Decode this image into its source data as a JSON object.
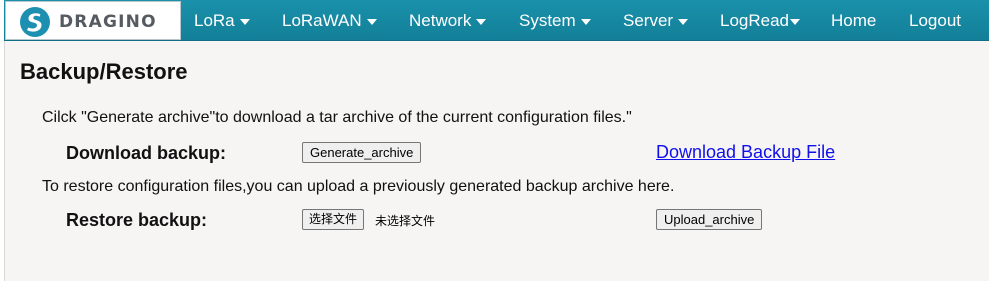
{
  "brand": {
    "logo_text": "DRAGINO"
  },
  "nav": {
    "lora": "LoRa",
    "lorawan": "LoRaWAN",
    "network": "Network",
    "system": "System",
    "server": "Server",
    "logread": "LogRead",
    "home": "Home",
    "logout": "Logout"
  },
  "page": {
    "title": "Backup/Restore",
    "download_intro": "Cilck \"Generate archive\"to download a tar archive of the current configuration files.\"",
    "download_label": "Download backup:",
    "generate_button": "Generate_archive",
    "download_link": "Download Backup File",
    "restore_intro": "To restore configuration files,you can upload a previously generated backup archive here.",
    "restore_label": "Restore backup:",
    "choose_file_button": "选择文件",
    "no_file_text": "未选择文件",
    "upload_button": "Upload_archive"
  }
}
